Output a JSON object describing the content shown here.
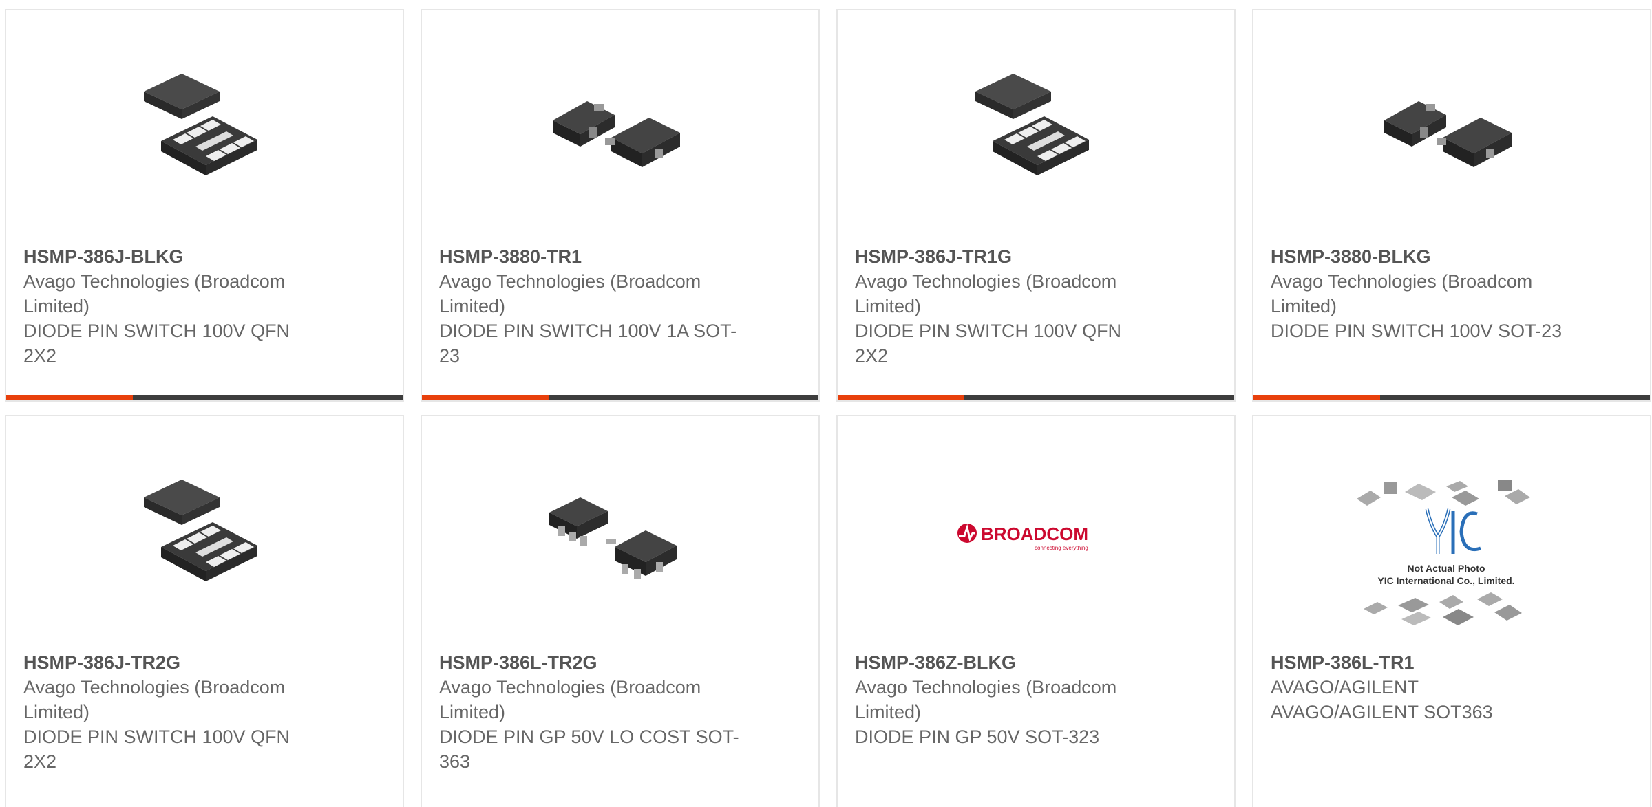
{
  "colors": {
    "accent": "#e8400c",
    "bar": "#3d3d3d",
    "text": "#666666",
    "border": "#e6e6e6",
    "broadcom_red": "#cc092f"
  },
  "products": [
    {
      "part": "HSMP-386J-BLKG",
      "manufacturer": "Avago Technologies (Broadcom Limited)",
      "description": "DIODE PIN SWITCH 100V QFN 2X2",
      "image": "qfn-package-icon"
    },
    {
      "part": "HSMP-3880-TR1",
      "manufacturer": "Avago Technologies (Broadcom Limited)",
      "description": "DIODE PIN SWITCH 100V 1A SOT-23",
      "image": "sot23-package-icon"
    },
    {
      "part": "HSMP-386J-TR1G",
      "manufacturer": "Avago Technologies (Broadcom Limited)",
      "description": "DIODE PIN SWITCH 100V QFN 2X2",
      "image": "qfn-package-icon"
    },
    {
      "part": "HSMP-3880-BLKG",
      "manufacturer": "Avago Technologies (Broadcom Limited)",
      "description": "DIODE PIN SWITCH 100V SOT-23",
      "image": "sot23-package-icon"
    },
    {
      "part": "HSMP-386J-TR2G",
      "manufacturer": "Avago Technologies (Broadcom Limited)",
      "description": "DIODE PIN SWITCH 100V QFN 2X2",
      "image": "qfn-package-icon"
    },
    {
      "part": "HSMP-386L-TR2G",
      "manufacturer": "Avago Technologies (Broadcom Limited)",
      "description": "DIODE PIN GP 50V LO COST SOT-363",
      "image": "sot363-package-icon"
    },
    {
      "part": "HSMP-386Z-BLKG",
      "manufacturer": "Avago Technologies (Broadcom Limited)",
      "description": "DIODE PIN GP 50V SOT-323",
      "image": "broadcom-logo",
      "logo_text": "BROADCOM",
      "logo_tagline": "connecting everything"
    },
    {
      "part": "HSMP-386L-TR1",
      "manufacturer": "AVAGO/AGILENT",
      "description": "AVAGO/AGILENT SOT363",
      "image": "yic-placeholder",
      "placeholder_logo": "YIC",
      "placeholder_line1": "Not Actual Photo",
      "placeholder_line2": "YIC International Co., Limited."
    }
  ]
}
